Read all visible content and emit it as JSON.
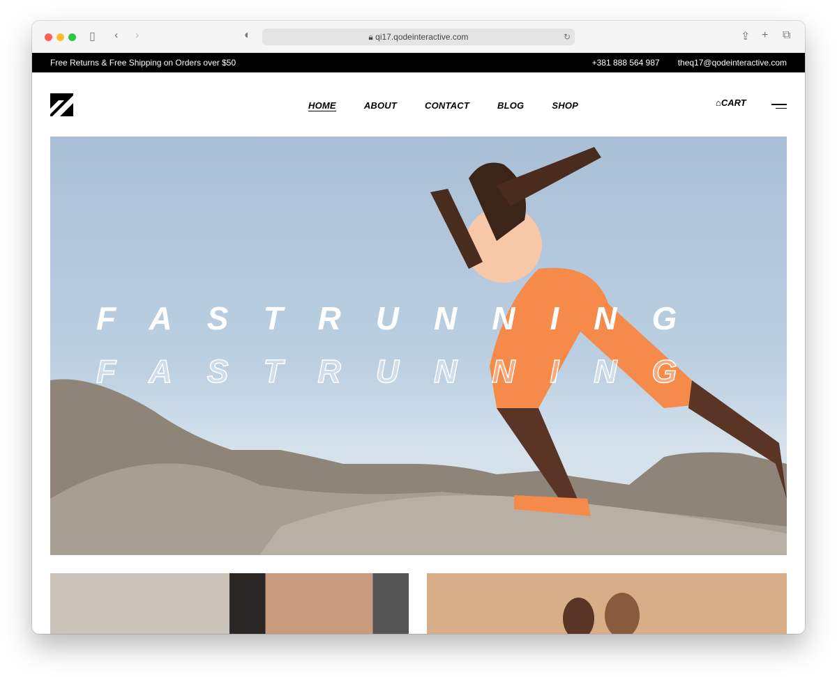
{
  "browser": {
    "url": "qi17.qodeinteractive.com"
  },
  "topbar": {
    "promo": "Free Returns & Free Shipping on Orders over $50",
    "phone": "+381 888 564 987",
    "email": "theq17@qodeinteractive.com"
  },
  "nav": {
    "items": [
      "HOME",
      "ABOUT",
      "CONTACT",
      "BLOG",
      "SHOP"
    ],
    "active": "HOME",
    "cart": "CART"
  },
  "hero": {
    "title": "FASTRUNNING",
    "outline_title": "FASTRUNNING"
  },
  "colors": {
    "topbar": "#000000",
    "sky": "#a9bfd6",
    "accent": "#f58a4b"
  }
}
